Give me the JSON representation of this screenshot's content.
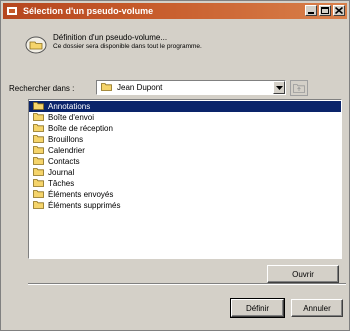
{
  "window": {
    "title": "Sélection d'un pseudo-volume",
    "minimize_label": "",
    "maximize_label": "",
    "close_label": ""
  },
  "header": {
    "title": "Définition d'un pseudo-volume...",
    "subtitle": "Ce dossier sera disponible dans tout le programme."
  },
  "search": {
    "label": "Rechercher dans :",
    "value": "Jean Dupont"
  },
  "folders": [
    {
      "label": "Annotations",
      "selected": true
    },
    {
      "label": "Boîte d'envoi"
    },
    {
      "label": "Boîte de réception"
    },
    {
      "label": "Brouillons"
    },
    {
      "label": "Calendrier"
    },
    {
      "label": "Contacts"
    },
    {
      "label": "Journal"
    },
    {
      "label": "Tâches"
    },
    {
      "label": "Éléments envoyés"
    },
    {
      "label": "Éléments supprimés"
    }
  ],
  "buttons": {
    "open": "Ouvrir",
    "define": "Définir",
    "cancel": "Annuler"
  },
  "colors": {
    "titlebar": "#c65a2a",
    "selection": "#0a246a",
    "folder": "#f5d46b"
  }
}
